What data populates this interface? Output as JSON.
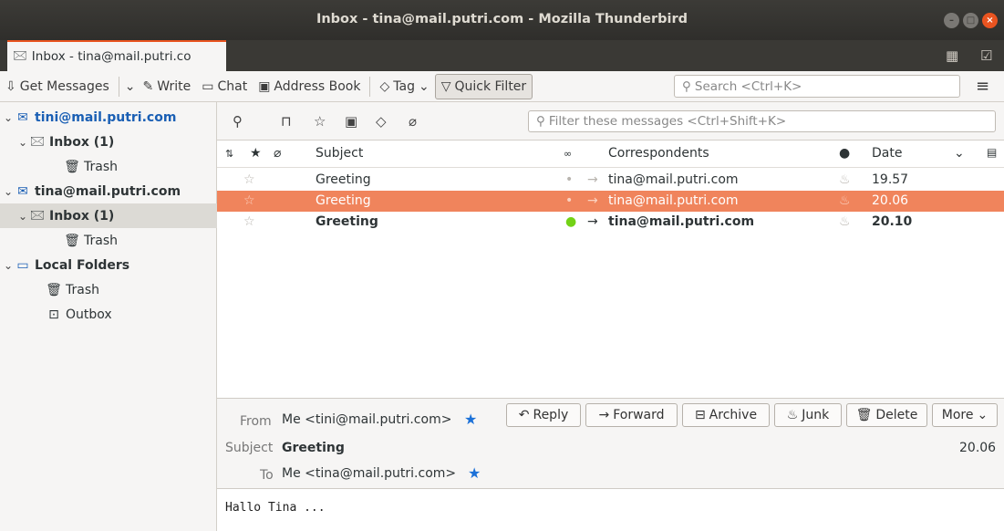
{
  "window": {
    "title": "Inbox - tina@mail.putri.com - Mozilla Thunderbird"
  },
  "tabs": [
    {
      "label": "Inbox - tina@mail.putri.co"
    }
  ],
  "toolbar": {
    "get_messages": "Get Messages",
    "write": "Write",
    "chat": "Chat",
    "address_book": "Address Book",
    "tag": "Tag",
    "quick_filter": "Quick Filter",
    "search_placeholder": "Search <Ctrl+K>"
  },
  "folders": [
    {
      "label": "tini@mail.putri.com"
    },
    {
      "label": "Inbox (1)"
    },
    {
      "label": "Trash"
    },
    {
      "label": "tina@mail.putri.com"
    },
    {
      "label": "Inbox (1)"
    },
    {
      "label": "Trash"
    },
    {
      "label": "Local Folders"
    },
    {
      "label": "Trash"
    },
    {
      "label": "Outbox"
    }
  ],
  "filter": {
    "placeholder": "Filter these messages <Ctrl+Shift+K>"
  },
  "columns": {
    "subject": "Subject",
    "correspondents": "Correspondents",
    "date": "Date"
  },
  "messages": [
    {
      "subject": "Greeting",
      "correspondent": "tina@mail.putri.com",
      "date": "19.57"
    },
    {
      "subject": "Greeting",
      "correspondent": "tina@mail.putri.com",
      "date": "20.06"
    },
    {
      "subject": "Greeting",
      "correspondent": "tina@mail.putri.com",
      "date": "20.10"
    }
  ],
  "header": {
    "from_label": "From",
    "from_value": "Me <tini@mail.putri.com>",
    "subject_label": "Subject",
    "subject_value": "Greeting",
    "to_label": "To",
    "to_value": "Me <tina@mail.putri.com>",
    "date": "20.06",
    "buttons": {
      "reply": "Reply",
      "forward": "Forward",
      "archive": "Archive",
      "junk": "Junk",
      "delete": "Delete",
      "more": "More"
    }
  },
  "body": {
    "text": "Hallo Tina ..."
  },
  "colors": {
    "accent": "#e95420",
    "selected_row": "#f0845c",
    "account_blue": "#1a5fb4",
    "unread_dot": "#73d216"
  }
}
